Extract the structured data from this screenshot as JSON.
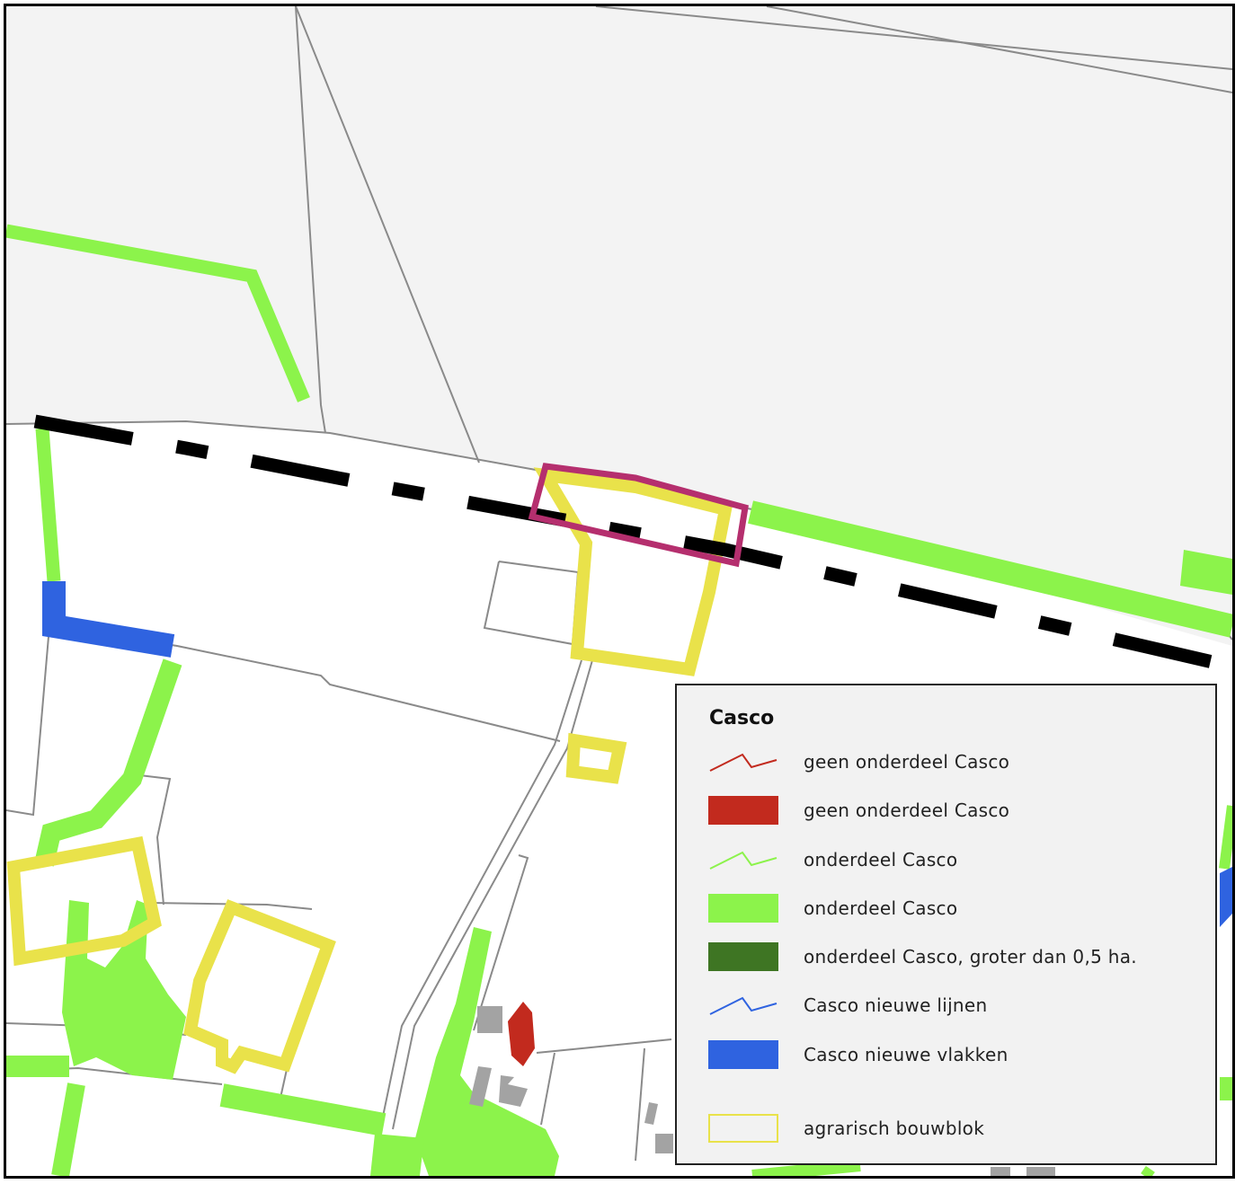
{
  "map": {
    "colors": {
      "background_outside": "#f3f3f3",
      "background_inside": "#ffffff",
      "parcel_line": "#8a8a8a",
      "boundary": "#000000",
      "casco_green": "#8cf34b",
      "casco_dark_green": "#3e7523",
      "casco_red": "#c22a1e",
      "casco_blue": "#2f63e0",
      "bouwblok_yellow": "#e9e24a",
      "highlight": "#b52f6e",
      "building_gray": "#a3a3a3"
    },
    "legend": {
      "title": "Casco",
      "items": [
        {
          "label": "geen onderdeel Casco",
          "symbol": "line",
          "color": "#c22a1e",
          "icon": "red-line-icon"
        },
        {
          "label": "geen onderdeel Casco",
          "symbol": "fill",
          "color": "#c22a1e",
          "icon": "red-area-icon"
        },
        {
          "label": "onderdeel Casco",
          "symbol": "line",
          "color": "#8cf34b",
          "icon": "green-line-icon"
        },
        {
          "label": "onderdeel Casco",
          "symbol": "fill",
          "color": "#8cf34b",
          "icon": "green-area-icon"
        },
        {
          "label": "onderdeel Casco, groter dan 0,5 ha.",
          "symbol": "fill",
          "color": "#3e7523",
          "icon": "dark-green-area-icon"
        },
        {
          "label": "Casco nieuwe lijnen",
          "symbol": "line",
          "color": "#2f63e0",
          "icon": "blue-line-icon"
        },
        {
          "label": "Casco nieuwe vlakken",
          "symbol": "fill",
          "color": "#2f63e0",
          "icon": "blue-area-icon"
        },
        {
          "label": "agrarisch bouwblok",
          "symbol": "outline",
          "color": "#e9e24a",
          "icon": "yellow-outline-icon"
        }
      ]
    }
  }
}
